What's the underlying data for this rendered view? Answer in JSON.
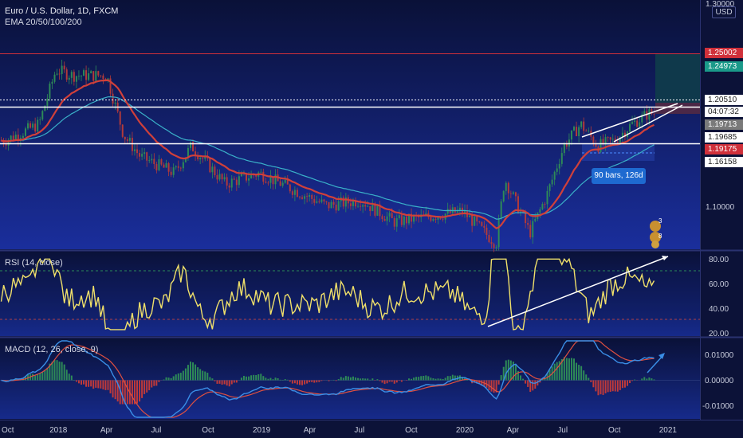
{
  "chart": {
    "title": "Euro / U.S. Dollar, 1D, FXCM",
    "indicator": "EMA 20/50/100/200",
    "currency": "USD",
    "top_tick": "1.30000",
    "price_ticks": [
      "1.10000"
    ],
    "price_labels": [
      {
        "text": "1.25002",
        "bg": "#d0303a",
        "fg": "#ffffff",
        "key": "upper-line"
      },
      {
        "text": "1.24973",
        "bg": "#1a9a8a",
        "fg": "#ffffff",
        "key": "target"
      },
      {
        "text": "1.20510",
        "bg": "#ffffff",
        "fg": "#222222",
        "key": "resistance"
      },
      {
        "text": "04:07:32",
        "bg": "#ffffff",
        "fg": "#222222",
        "key": "countdown"
      },
      {
        "text": "1.19713",
        "bg": "#7a7a7a",
        "fg": "#ffffff",
        "key": "last"
      },
      {
        "text": "1.19685",
        "bg": "#ffffff",
        "fg": "#222222",
        "key": "support"
      },
      {
        "text": "1.19175",
        "bg": "#d0303a",
        "fg": "#ffffff",
        "key": "stop"
      },
      {
        "text": "1.16158",
        "bg": "#ffffff",
        "fg": "#222222",
        "key": "range-low"
      }
    ],
    "range_callout": "90 bars, 126d",
    "badges": [
      "3",
      "8"
    ]
  },
  "rsi": {
    "label": "RSI (14, close)",
    "ticks": [
      "80.00",
      "60.00",
      "40.00",
      "20.00"
    ]
  },
  "macd": {
    "label": "MACD (12, 26, close, 9)",
    "ticks": [
      "0.01000",
      "0.00000",
      "-0.01000"
    ]
  },
  "time_axis": [
    "Oct",
    "2018",
    "Apr",
    "Jul",
    "Oct",
    "2019",
    "Apr",
    "Jul",
    "Oct",
    "2020",
    "Apr",
    "Jul",
    "Oct",
    "2021"
  ],
  "colors": {
    "background": "#0a1040",
    "bull_candle": "#2e8b57",
    "bear_candle": "#b23a3a",
    "ema20": "#d0403a",
    "ema50": "#3ab0c8",
    "rsi_line": "#f0e06a",
    "macd_line": "#3a8ee6",
    "signal_line": "#e05040",
    "resistance": "#ffffff",
    "upper_line": "#d0303a"
  },
  "chart_data": {
    "type": "candlestick",
    "symbol": "EURUSD",
    "timeframe": "1D",
    "x_range": [
      "2017-10",
      "2020-12"
    ],
    "y_range": [
      1.08,
      1.3
    ],
    "key_levels": [
      1.25002,
      1.24973,
      1.2051,
      1.19713,
      1.19685,
      1.19175,
      1.16158
    ],
    "price_path": [
      {
        "x": "2017-10",
        "y": 1.175
      },
      {
        "x": "2017-12",
        "y": 1.19
      },
      {
        "x": "2018-01",
        "y": 1.24
      },
      {
        "x": "2018-02",
        "y": 1.235
      },
      {
        "x": "2018-04",
        "y": 1.235
      },
      {
        "x": "2018-05",
        "y": 1.18
      },
      {
        "x": "2018-06",
        "y": 1.16
      },
      {
        "x": "2018-08",
        "y": 1.145
      },
      {
        "x": "2018-09",
        "y": 1.17
      },
      {
        "x": "2018-11",
        "y": 1.135
      },
      {
        "x": "2019-01",
        "y": 1.145
      },
      {
        "x": "2019-03",
        "y": 1.13
      },
      {
        "x": "2019-05",
        "y": 1.115
      },
      {
        "x": "2019-07",
        "y": 1.12
      },
      {
        "x": "2019-09",
        "y": 1.1
      },
      {
        "x": "2019-11",
        "y": 1.105
      },
      {
        "x": "2020-01",
        "y": 1.11
      },
      {
        "x": "2020-03",
        "y": 1.08
      },
      {
        "x": "2020-03",
        "y": 1.14
      },
      {
        "x": "2020-05",
        "y": 1.09
      },
      {
        "x": "2020-06",
        "y": 1.125
      },
      {
        "x": "2020-07",
        "y": 1.17
      },
      {
        "x": "2020-08",
        "y": 1.19
      },
      {
        "x": "2020-09",
        "y": 1.17
      },
      {
        "x": "2020-10",
        "y": 1.175
      },
      {
        "x": "2020-11",
        "y": 1.19
      },
      {
        "x": "2020-12",
        "y": 1.2
      }
    ],
    "rsi_range": [
      20,
      80
    ],
    "macd_range": [
      -0.01,
      0.01
    ]
  }
}
